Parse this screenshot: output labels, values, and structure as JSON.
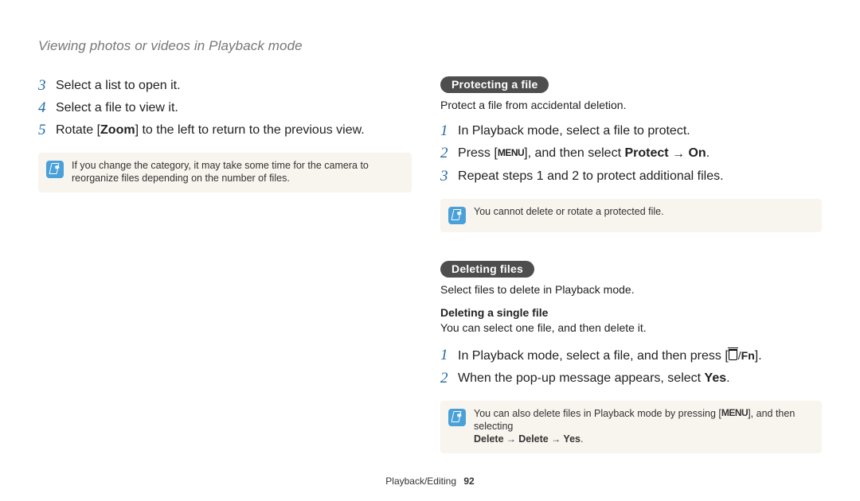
{
  "header": {
    "title": "Viewing photos or videos in Playback mode"
  },
  "left": {
    "steps": [
      {
        "num": "3",
        "text": "Select a list to open it."
      },
      {
        "num": "4",
        "text": "Select a file to view it."
      },
      {
        "num": "5",
        "pre": "Rotate [",
        "bold": "Zoom",
        "post": "] to the left to return to the previous view."
      }
    ],
    "note": "If you change the category, it may take some time for the camera to reorganize files depending on the number of files."
  },
  "right": {
    "protect": {
      "chip": "Protecting a file",
      "desc": "Protect a file from accidental deletion.",
      "steps": [
        {
          "num": "1",
          "text": "In Playback mode, select a file to protect."
        },
        {
          "num": "2",
          "pre": "Press [",
          "menu": "MENU",
          "post1": "], and then select ",
          "bold1": "Protect",
          "arrow": " → ",
          "bold2": "On",
          "tail": "."
        },
        {
          "num": "3",
          "text": "Repeat steps 1 and 2 to protect additional files."
        }
      ],
      "note": "You cannot delete or rotate a protected file."
    },
    "delete": {
      "chip": "Deleting files",
      "desc": "Select files to delete in Playback mode.",
      "subhead": "Deleting a single file",
      "subdesc": "You can select one file, and then delete it.",
      "steps": [
        {
          "num": "1",
          "pre": "In Playback mode, select a file, and then press [",
          "trash": true,
          "fn": "Fn",
          "post": "]."
        },
        {
          "num": "2",
          "pre": "When the pop-up message appears, select ",
          "bold": "Yes",
          "post": "."
        }
      ],
      "note_pre": "You can also delete files in Playback mode by pressing [",
      "note_menu": "MENU",
      "note_post1": "], and then selecting ",
      "note_bold1": "Delete",
      "note_arrow": " → ",
      "note_bold2": "Delete",
      "note_bold3": "Yes",
      "note_tail": "."
    }
  },
  "footer": {
    "section": "Playback/Editing",
    "page": "92"
  }
}
